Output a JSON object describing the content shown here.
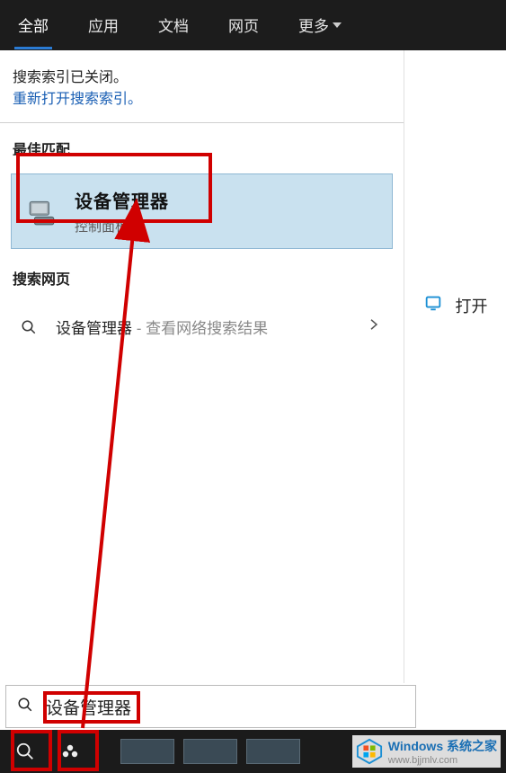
{
  "tabs": {
    "all": "全部",
    "apps": "应用",
    "docs": "文档",
    "web": "网页",
    "more": "更多"
  },
  "notice": {
    "line1": "搜索索引已关闭。",
    "link": "重新打开搜索索引。"
  },
  "sections": {
    "best_match": "最佳匹配",
    "web_search": "搜索网页"
  },
  "best_result": {
    "title": "设备管理器",
    "subtitle": "控制面板"
  },
  "web_result": {
    "query": "设备管理器",
    "suffix": " - 查看网络搜索结果"
  },
  "right_panel": {
    "open_label": "打开"
  },
  "search": {
    "value": "设备管理器"
  },
  "watermark": {
    "title": "Windows 系统之家",
    "url": "www.bjjmlv.com"
  }
}
